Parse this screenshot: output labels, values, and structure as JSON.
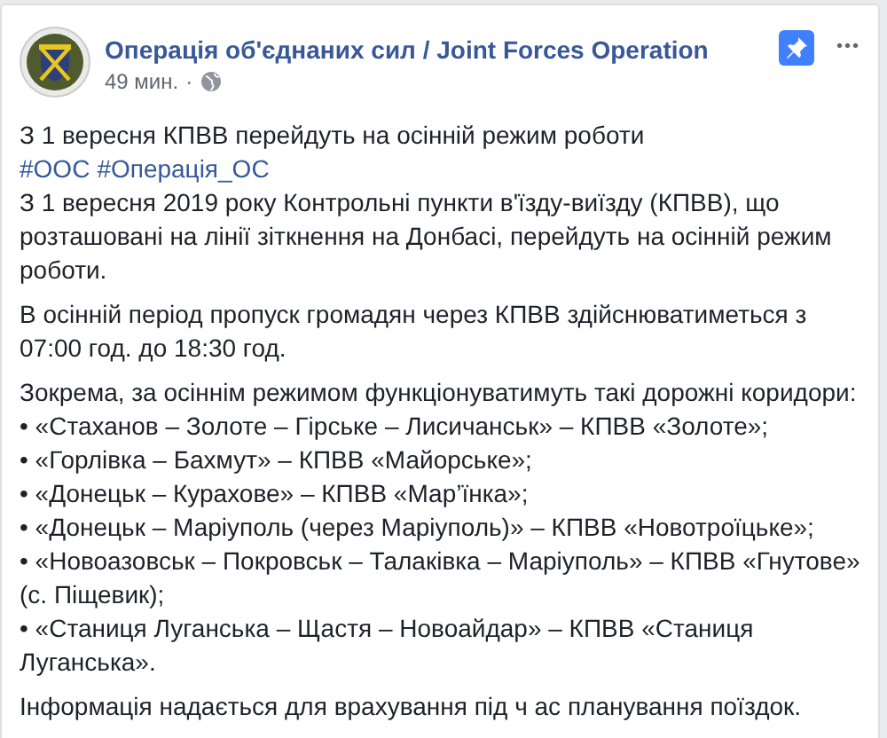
{
  "post": {
    "author": "Операція об'єднаних сил / Joint Forces Operation",
    "time": "49 мин.",
    "separator": "·",
    "pinned": true,
    "menu": "•••",
    "headline": "З 1 вересня КПВВ перейдуть на осінній режим роботи",
    "hashtags": [
      "#ООС",
      "#Операція_ОС"
    ],
    "paragraphs": [
      "З 1 вересня 2019 року Контрольні пункти в'їзду-виїзду (КПВВ), що розташовані на лінії зіткнення на Донбасі, перейдуть на осінній режим роботи.",
      "В осінній період пропуск громадян через КПВВ здійснюватиметься з 07:00 год. до 18:30 год."
    ],
    "list_intro": "Зокрема, за осіннім режимом функціонуватимуть такі дорожні коридори:",
    "bullets": [
      "• «Стаханов – Золоте – Гірське – Лисичанськ» – КПВВ «Золоте»;",
      "• «Горлівка – Бахмут» – КПВВ «Майорське»;",
      "• «Донецьк – Курахове» – КПВВ «Мар’їнка»;",
      "• «Донецьк – Маріуполь (через Маріуполь)» – КПВВ «Новотроїцьке»;",
      "• «Новоазовськ – Покровськ – Талаківка – Маріуполь» – КПВВ «Гнутове» (с. Піщевик);",
      "• «Станиця Луганська – Щастя – Новоайдар» – КПВВ «Станиця Луганська»."
    ],
    "closing": "Інформація надається для врахування під ч ас планування поїздок."
  }
}
